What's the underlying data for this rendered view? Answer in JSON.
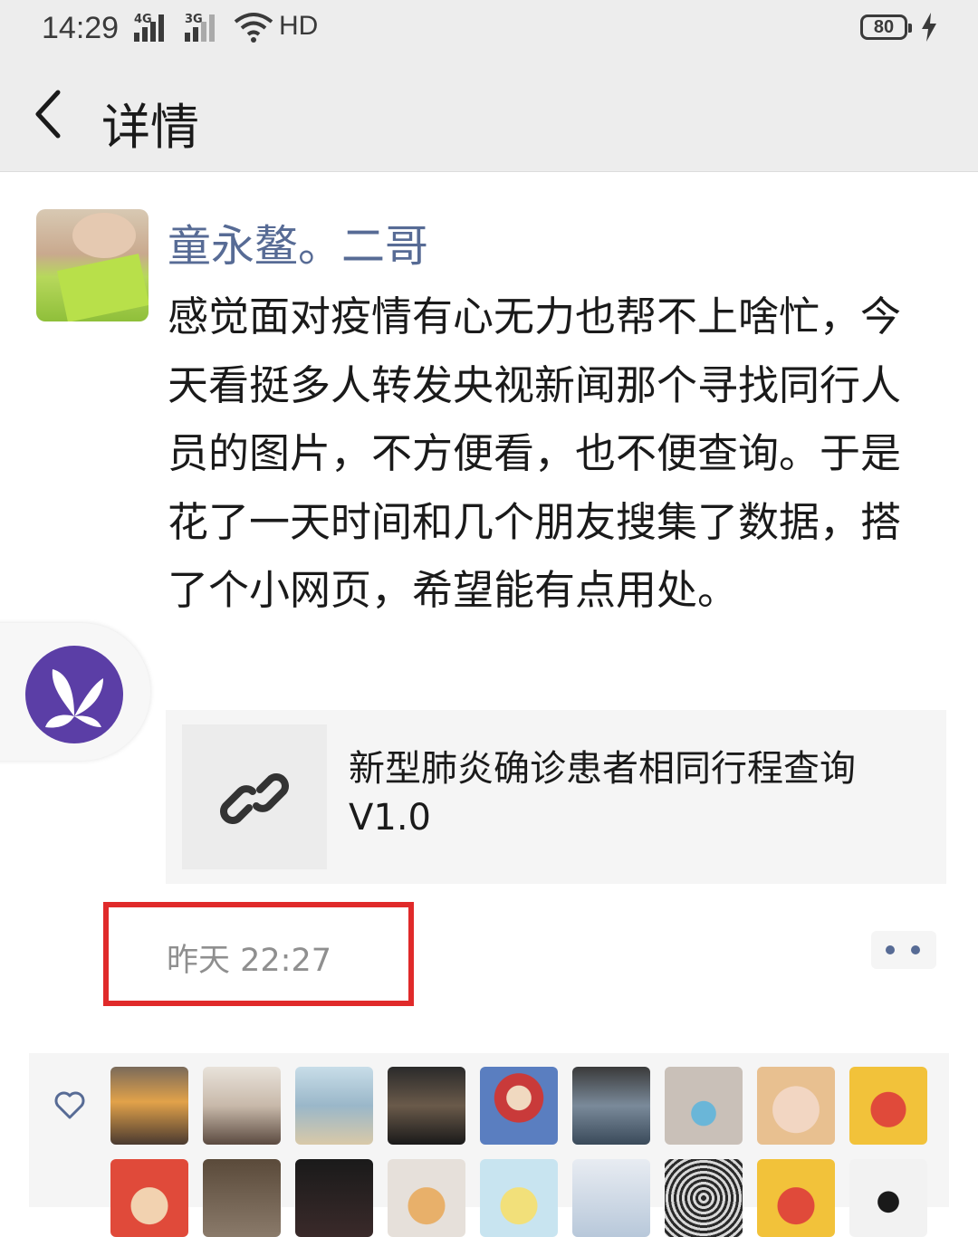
{
  "status_bar": {
    "time": "14:29",
    "network_1": "4G",
    "network_2": "3G",
    "hd_label": "HD",
    "battery_level": "80"
  },
  "header": {
    "title": "详情"
  },
  "post": {
    "author": "童永鳌。二哥",
    "text": "感觉面对疫情有心无力也帮不上啥忙，今天看挺多人转发央视新闻那个寻找同行人员的图片，不方便看，也不便查询。于是花了一天时间和几个朋友搜集了数据，搭了个小网页，希望能有点用处。",
    "link_title": "新型肺炎确诊患者相同行程查询V1.0",
    "timestamp": "昨天 22:27"
  },
  "colors": {
    "name_link": "#576b95",
    "highlight_box": "#e02a2a",
    "floating_app": "#5b3ea6",
    "header_bg": "#ededed"
  },
  "icons": [
    "back-arrow-icon",
    "link-icon",
    "heart-icon",
    "more-dots-icon",
    "butterfly-icon"
  ]
}
